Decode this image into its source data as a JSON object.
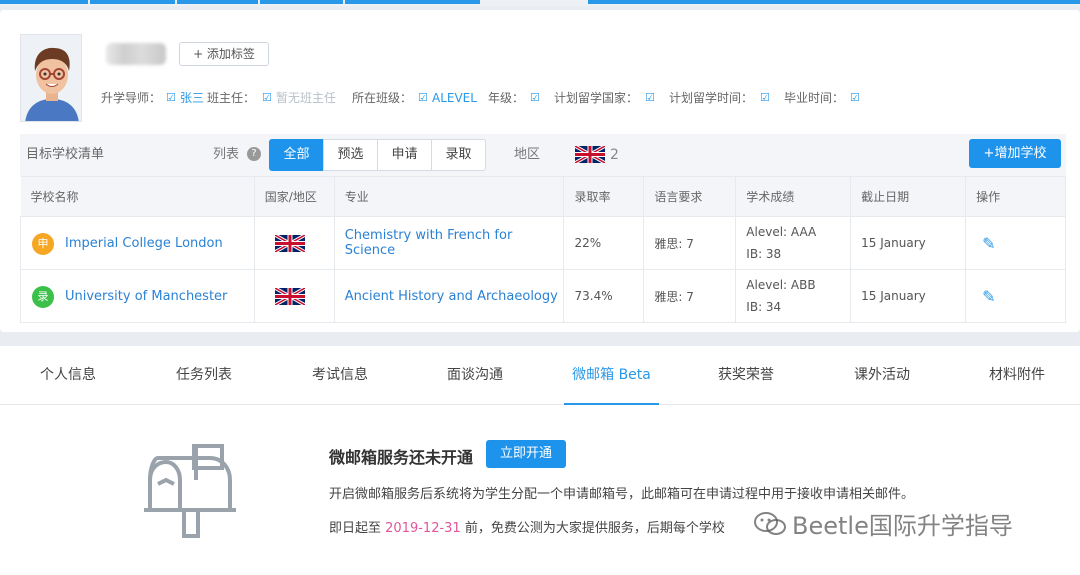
{
  "student": {
    "add_tag_label": "+ 添加标签",
    "info": {
      "advisor_label": "升学导师：",
      "advisor_value": "张三",
      "homeroom_label": "班主任：",
      "homeroom_value": "暂无班主任",
      "class_label": "所在班级：",
      "class_value": "ALEVEL",
      "grade_label": "年级：",
      "country_label": "计划留学国家：",
      "time_label": "计划留学时间：",
      "graduation_label": "毕业时间："
    }
  },
  "toolbar": {
    "title": "目标学校清单",
    "list_label": "列表",
    "help_icon": "?",
    "filters": [
      "全部",
      "预选",
      "申请",
      "录取"
    ],
    "active_filter": "全部",
    "region_label": "地区",
    "region_count": "2",
    "add_button": "+增加学校"
  },
  "table": {
    "headers": [
      "学校名称",
      "国家/地区",
      "专业",
      "录取率",
      "语言要求",
      "学术成绩",
      "截止日期",
      "操作"
    ],
    "rows": [
      {
        "status": "申",
        "status_color": "#f5a623",
        "school": "Imperial College London",
        "flag": "uk-flag-icon",
        "major": "Chemistry with French for Science",
        "rate": "22%",
        "language": "雅思: 7",
        "score_line1": "Alevel: AAA",
        "score_line2": "IB: 38",
        "deadline": "15 January"
      },
      {
        "status": "录",
        "status_color": "#3cc04a",
        "school": "University of Manchester",
        "flag": "uk-flag-icon",
        "major": "Ancient History and Archaeology",
        "rate": "73.4%",
        "language": "雅思: 7",
        "score_line1": "Alevel: ABB",
        "score_line2": "IB: 34",
        "deadline": "15 January"
      }
    ]
  },
  "tabs": [
    "个人信息",
    "任务列表",
    "考试信息",
    "面谈沟通",
    "微邮箱 Beta",
    "获奖荣誉",
    "课外活动",
    "材料附件"
  ],
  "active_tab": "微邮箱 Beta",
  "mailbox": {
    "title": "微邮箱服务还未开通",
    "open_button": "立即开通",
    "desc1": "开启微邮箱服务后系统将为学生分配一个申请邮箱号，此邮箱可在申请过程中用于接收申请相关邮件。",
    "desc2_prefix": "即日起至",
    "desc2_date": "2019-12-31",
    "desc2_suffix": "前，免费公测为大家提供服务，后期每个学校"
  },
  "watermark": "Beetle国际升学指导",
  "colors": {
    "accent": "#1e93ec",
    "link": "#2a82d4",
    "highlight_date": "#e2559a"
  }
}
